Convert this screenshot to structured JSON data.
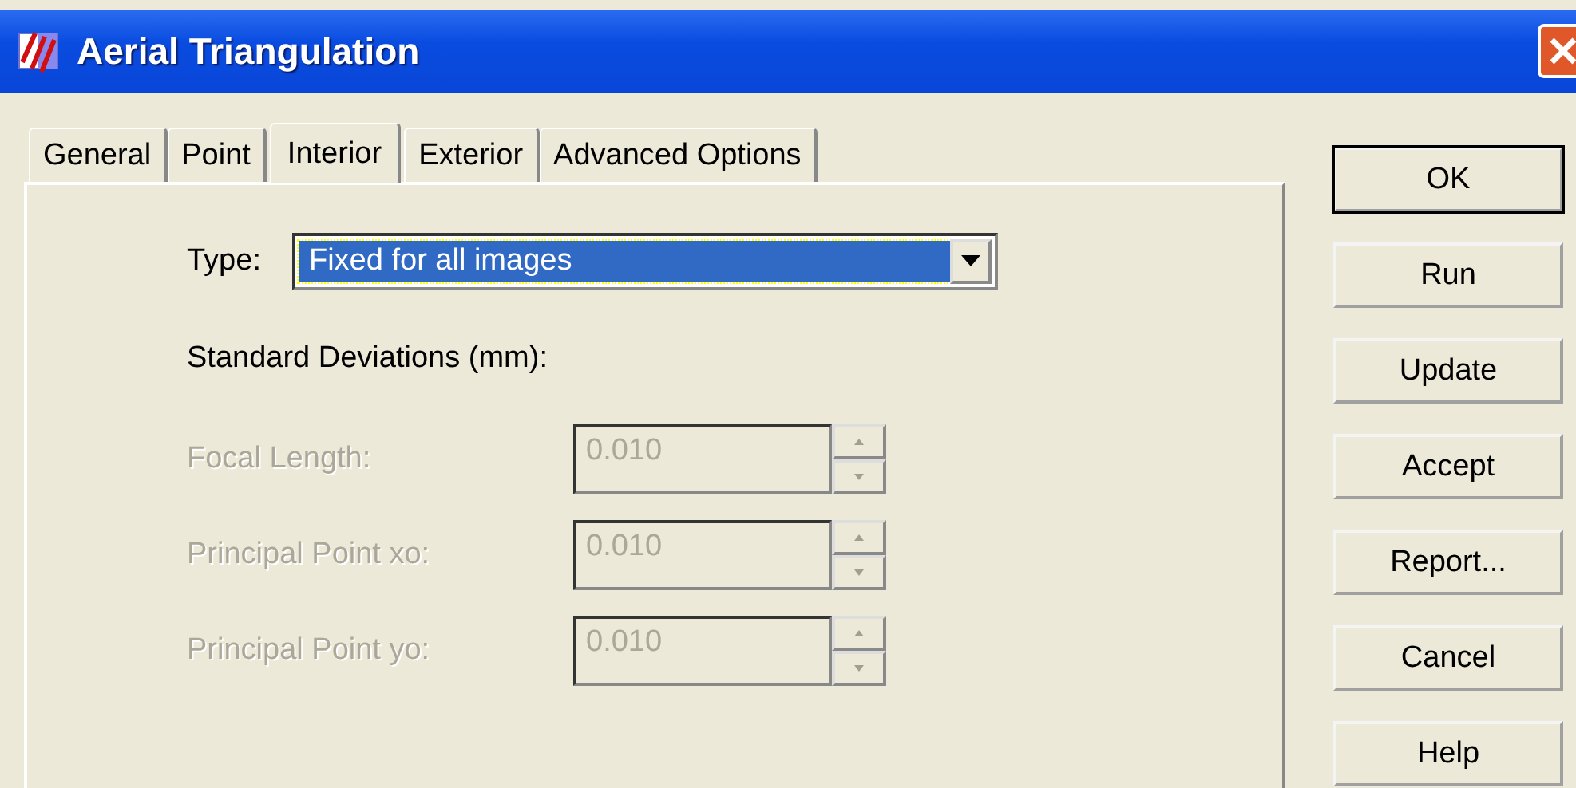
{
  "window": {
    "title": "Aerial Triangulation"
  },
  "tabs": [
    {
      "label": "General",
      "selected": false
    },
    {
      "label": "Point",
      "selected": false
    },
    {
      "label": "Interior",
      "selected": true
    },
    {
      "label": "Exterior",
      "selected": false
    },
    {
      "label": "Advanced Options",
      "selected": false
    }
  ],
  "type_field": {
    "label": "Type:",
    "value": "Fixed for all images"
  },
  "section_label": "Standard Deviations (mm):",
  "deviations": [
    {
      "label": "Focal Length:",
      "value": "0.010",
      "disabled": true
    },
    {
      "label": "Principal Point xo:",
      "value": "0.010",
      "disabled": true
    },
    {
      "label": "Principal Point yo:",
      "value": "0.010",
      "disabled": true
    }
  ],
  "buttons": [
    {
      "label": "OK",
      "default": true
    },
    {
      "label": "Run",
      "default": false
    },
    {
      "label": "Update",
      "default": false
    },
    {
      "label": "Accept",
      "default": false
    },
    {
      "label": "Report...",
      "default": false
    },
    {
      "label": "Cancel",
      "default": false
    },
    {
      "label": "Help",
      "default": false
    }
  ]
}
